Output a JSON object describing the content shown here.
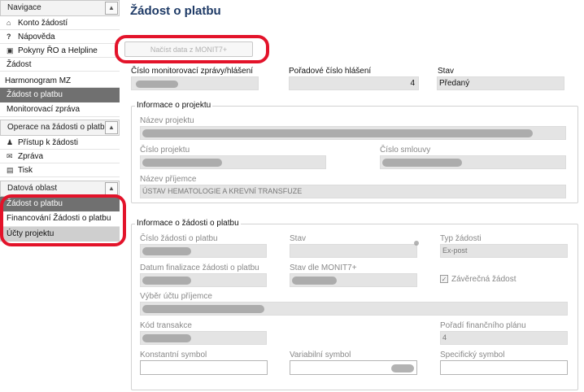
{
  "sidebar": {
    "navigation_header": "Navigace",
    "nav_items": [
      {
        "label": "Konto žádostí",
        "icon": "home-icon"
      },
      {
        "label": "Nápověda",
        "icon": "help-icon"
      },
      {
        "label": "Pokyny ŘO a Helpline",
        "icon": "info-icon"
      }
    ],
    "plain_items": [
      "Žádost",
      "Harmonogram MZ"
    ],
    "active_section": "Žádost o platbu",
    "monitor_report": "Monitorovací zpráva",
    "operations_header": "Operace na žádosti o platbu",
    "operations_items": [
      {
        "label": "Přístup k žádosti",
        "icon": "users-icon"
      },
      {
        "label": "Zpráva",
        "icon": "envelope-icon"
      },
      {
        "label": "Tisk",
        "icon": "print-icon"
      }
    ],
    "data_area_header": "Datová oblast",
    "data_area_active": "Žádost o platbu",
    "data_area_items": [
      "Financování Žádosti o platbu",
      "Účty projektu"
    ]
  },
  "main": {
    "title": "Žádost o platbu",
    "load_button": "Načíst data z MONIT7+",
    "top_fields": {
      "report_number_label": "Číslo monitorovací zprávy/hlášení",
      "sequence_label": "Pořadové číslo hlášení",
      "sequence_value": "4",
      "status_label": "Stav",
      "status_value": "Předaný"
    },
    "project_info": {
      "title": "Informace o projektu",
      "name_label": "Název projektu",
      "number_label": "Číslo projektu",
      "contract_label": "Číslo smlouvy",
      "recipient_label": "Název příjemce",
      "recipient_value": "ÚSTAV HEMATOLOGIE A KREVNÍ TRANSFUZE"
    },
    "payment_info": {
      "title": "Informace o žádosti o platbu",
      "request_number_label": "Číslo žádosti o platbu",
      "status_label": "Stav",
      "type_label": "Typ žádosti",
      "type_value": "Ex-post",
      "finalization_label": "Datum finalizace žádosti o platbu",
      "monit_status_label": "Stav dle MONIT7+",
      "final_request_label": "Závěrečná žádost",
      "account_label": "Výběr účtu příjemce",
      "transaction_label": "Kód transakce",
      "plan_order_label": "Pořadí finančního plánu",
      "plan_order_value": "4",
      "constant_symbol_label": "Konstantní symbol",
      "variable_symbol_label": "Variabilní symbol",
      "specific_symbol_label": "Specifický symbol"
    }
  },
  "colors": {
    "title": "#1e3a66",
    "highlight_ring": "#e3132a",
    "sidebar_active": "#707070",
    "field_readonly": "#e4e4e4"
  }
}
